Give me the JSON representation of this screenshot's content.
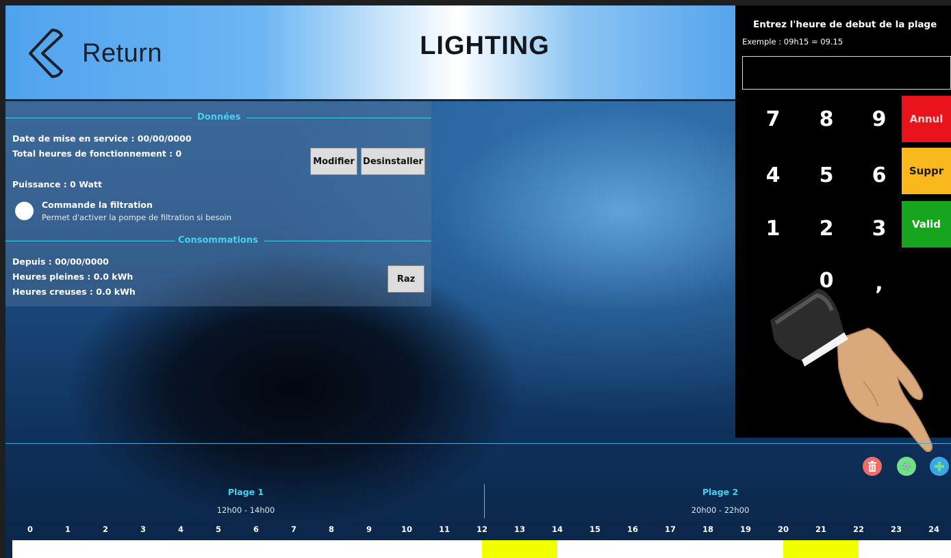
{
  "header": {
    "return_label": "Return",
    "title": "LIGHTING"
  },
  "data_panel": {
    "section_data_title": "Données",
    "date_service": "Date de mise en service : 00/00/0000",
    "total_hours": "Total heures de fonctionnement : 0",
    "modify_label": "Modifier",
    "uninstall_label": "Desinstaller",
    "power": "Puissance : 0 Watt",
    "filtration_title": "Commande la filtration",
    "filtration_desc": "Permet d'activer la pompe de filtration si besoin",
    "filtration_enabled": false,
    "section_consumption_title": "Consommations",
    "since": "Depuis : 00/00/0000",
    "peak_hours": "Heures pleines : 0.0 kWh",
    "off_peak_hours": "Heures creuses : 0.0 kWh",
    "reset_label": "Raz"
  },
  "keypad": {
    "instruction": "Entrez l'heure de debut de la plage",
    "example": "Exemple : 09h15 = 09.15",
    "input_value": "",
    "keys": [
      "7",
      "8",
      "9",
      "4",
      "5",
      "6",
      "1",
      "2",
      "3",
      "0",
      ","
    ],
    "cancel_label": "Annul",
    "delete_label": "Suppr",
    "validate_label": "Valid",
    "colors": {
      "cancel": "#e8131b",
      "delete": "#f9b81b",
      "validate": "#17a51f"
    }
  },
  "actions": {
    "icons": [
      "trash-icon",
      "gear-icon",
      "plus-icon"
    ],
    "colors": {
      "trash": "#f26b6b",
      "settings": "#6ee28a",
      "add": "#39a6e6"
    }
  },
  "schedule": {
    "plages": [
      {
        "title": "Plage 1",
        "time": "12h00 - 14h00",
        "start": 12,
        "end": 14
      },
      {
        "title": "Plage 2",
        "time": "20h00 - 22h00",
        "start": 20,
        "end": 22
      }
    ],
    "hours": [
      "0",
      "1",
      "2",
      "3",
      "4",
      "5",
      "6",
      "7",
      "8",
      "9",
      "10",
      "11",
      "12",
      "13",
      "14",
      "15",
      "16",
      "17",
      "18",
      "19",
      "20",
      "21",
      "22",
      "23",
      "24"
    ],
    "highlight_color": "#f2ff00"
  }
}
